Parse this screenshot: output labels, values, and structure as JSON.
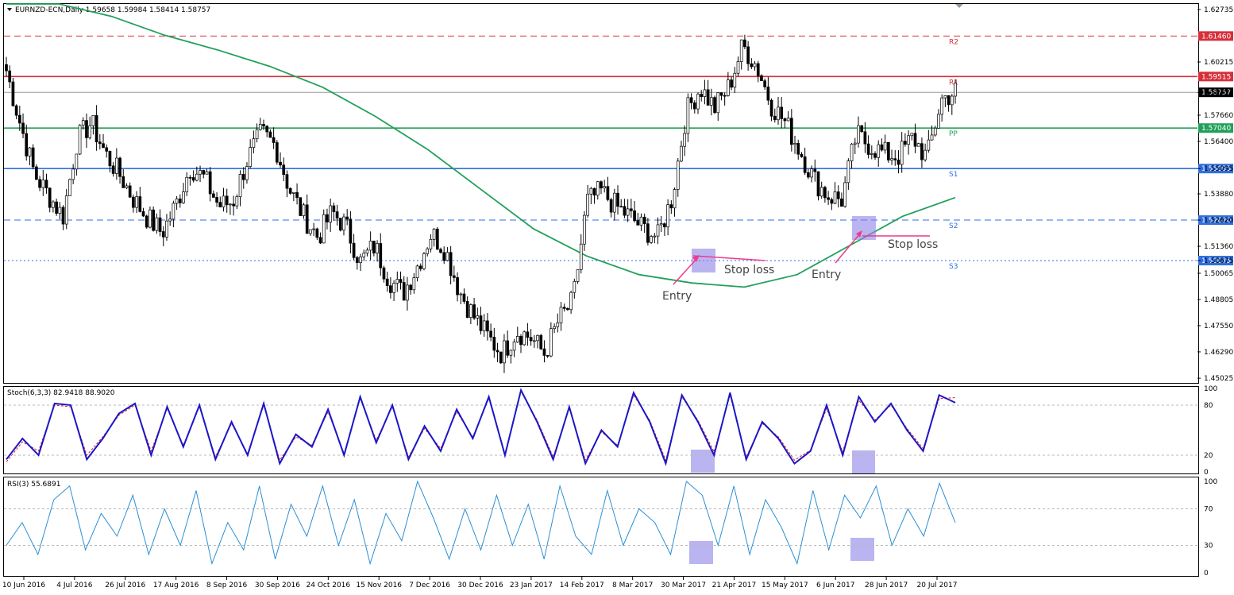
{
  "symbol_header": "EURNZD-ECN,Daily  1.59658 1.59984 1.58414 1.58757",
  "colors": {
    "background": "#ffffff",
    "frame": "#000000",
    "candle_bull_body": "#ffffff",
    "candle_bear_body": "#000000",
    "ma200": "#22a05a",
    "pivot_r": "#d6303a",
    "pivot_pp": "#22a05a",
    "pivot_s": "#2f6fe0",
    "highlight": "#8c82e6",
    "arrow": "#ee3b8c",
    "stoch_main": "#1a16c8",
    "stoch_signal": "#e02020",
    "rsi": "#2b8fd6",
    "current_price_box": "#000000"
  },
  "price_axis": {
    "min": 1.448,
    "max": 1.63,
    "labels": [
      "1.62735",
      "1.60215",
      "1.58757",
      "1.57660",
      "1.56400",
      "1.55095",
      "1.53880",
      "1.52620",
      "1.51360",
      "1.50675",
      "1.50065",
      "1.48805",
      "1.47550",
      "1.46290",
      "1.45025"
    ],
    "label_values": [
      1.62735,
      1.60215,
      1.58757,
      1.5766,
      1.564,
      1.55095,
      1.5388,
      1.5262,
      1.5136,
      1.50675,
      1.50065,
      1.48805,
      1.4755,
      1.4629,
      1.45025
    ]
  },
  "pivots": [
    {
      "name": "R2",
      "value": 1.6146,
      "label": "1.61460",
      "style": "dashed",
      "color": "#d6303a"
    },
    {
      "name": "R1",
      "value": 1.59515,
      "label": "1.59515",
      "style": "solid",
      "color": "#d6303a"
    },
    {
      "name": "PP",
      "value": 1.5704,
      "label": "1.57040",
      "style": "solid",
      "color": "#22a05a"
    },
    {
      "name": "S1",
      "value": 1.55095,
      "label": "1.55095",
      "style": "solid",
      "color": "#2f6fe0"
    },
    {
      "name": "S2",
      "value": 1.5262,
      "label": "1.52620",
      "style": "dashed",
      "color": "#2f6fe0"
    },
    {
      "name": "S3",
      "value": 1.50675,
      "label": "1.50675",
      "style": "dotted",
      "color": "#2f6fe0"
    }
  ],
  "current_price": {
    "value": 1.58757,
    "label": "1.58757"
  },
  "chart_data": {
    "type": "line",
    "title": "EURNZD-ECN,Daily",
    "x_dates": [
      "10 Jun 2016",
      "4 Jul 2016",
      "26 Jul 2016",
      "17 Aug 2016",
      "8 Sep 2016",
      "30 Sep 2016",
      "24 Oct 2016",
      "15 Nov 2016",
      "7 Dec 2016",
      "30 Dec 2016",
      "23 Jan 2017",
      "14 Feb 2017",
      "8 Mar 2017",
      "30 Mar 2017",
      "21 Apr 2017",
      "15 May 2017",
      "6 Jun 2017",
      "28 Jun 2017",
      "20 Jul 2017"
    ],
    "ylim": [
      1.448,
      1.63
    ],
    "series": [
      {
        "name": "",
        "values": [
          1.598,
          1.572,
          1.548,
          1.538,
          1.528,
          1.565,
          1.573,
          1.558,
          1.548,
          1.536,
          1.527,
          1.52,
          1.534,
          1.552,
          1.546,
          1.533,
          1.535,
          1.555,
          1.568,
          1.562,
          1.541,
          1.528,
          1.518,
          1.53,
          1.523,
          1.506,
          1.514,
          1.498,
          1.491,
          1.504,
          1.52,
          1.512,
          1.492,
          1.48,
          1.47,
          1.462,
          1.473,
          1.47,
          1.462,
          1.478,
          1.487,
          1.535,
          1.54,
          1.533,
          1.528,
          1.522,
          1.518,
          1.537,
          1.578,
          1.59,
          1.58,
          1.59,
          1.61,
          1.6,
          1.582,
          1.573,
          1.56,
          1.546,
          1.538,
          1.536,
          1.567,
          1.562,
          1.558,
          1.557,
          1.566,
          1.556,
          1.584,
          1.588
        ]
      }
    ]
  },
  "moving_average": {
    "name": "",
    "values": [
      1.64,
      1.632,
      1.624,
      1.615,
      1.608,
      1.6,
      1.59,
      1.576,
      1.56,
      1.541,
      1.522,
      1.509,
      1.5,
      1.496,
      1.494,
      1.5,
      1.514,
      1.528,
      1.537
    ]
  },
  "annotations": [
    {
      "id": "entry-1",
      "text": "Entry"
    },
    {
      "id": "stop-1",
      "text": "Stop loss"
    },
    {
      "id": "entry-2",
      "text": "Entry"
    },
    {
      "id": "stop-2",
      "text": "Stop loss"
    }
  ],
  "stoch": {
    "header": "Stoch(6,3,3) 82.9418 88.9020",
    "levels": [
      "100",
      "80",
      "20",
      "0"
    ],
    "level_values": [
      100,
      80,
      20,
      0
    ],
    "main": [
      15,
      40,
      20,
      82,
      80,
      15,
      40,
      70,
      82,
      20,
      78,
      30,
      80,
      15,
      60,
      20,
      82,
      10,
      45,
      30,
      75,
      20,
      90,
      35,
      80,
      15,
      55,
      25,
      75,
      40,
      90,
      20,
      98,
      60,
      15,
      78,
      10,
      50,
      30,
      95,
      60,
      10,
      92,
      60,
      20,
      95,
      15,
      60,
      40,
      10,
      25,
      80,
      20,
      90,
      60,
      82,
      50,
      25,
      92,
      83
    ],
    "signal": [
      12,
      36,
      25,
      80,
      78,
      20,
      42,
      68,
      80,
      25,
      76,
      32,
      78,
      18,
      58,
      22,
      80,
      14,
      42,
      32,
      72,
      22,
      88,
      38,
      78,
      18,
      52,
      28,
      72,
      42,
      88,
      22,
      96,
      62,
      18,
      76,
      14,
      48,
      32,
      92,
      62,
      14,
      90,
      62,
      24,
      92,
      18,
      58,
      42,
      14,
      26,
      76,
      24,
      86,
      62,
      80,
      52,
      28,
      88,
      89
    ]
  },
  "rsi": {
    "header": "RSI(3) 55.6891",
    "levels": [
      "100",
      "70",
      "30",
      "0"
    ],
    "level_values": [
      100,
      70,
      30,
      0
    ],
    "values": [
      30,
      55,
      20,
      80,
      95,
      25,
      65,
      40,
      85,
      20,
      70,
      30,
      90,
      10,
      55,
      25,
      95,
      15,
      75,
      40,
      95,
      30,
      80,
      10,
      65,
      35,
      100,
      60,
      15,
      70,
      25,
      85,
      30,
      75,
      15,
      95,
      40,
      20,
      90,
      30,
      70,
      55,
      20,
      100,
      85,
      30,
      95,
      20,
      80,
      50,
      10,
      90,
      25,
      85,
      60,
      95,
      30,
      70,
      40,
      98,
      55
    ]
  }
}
